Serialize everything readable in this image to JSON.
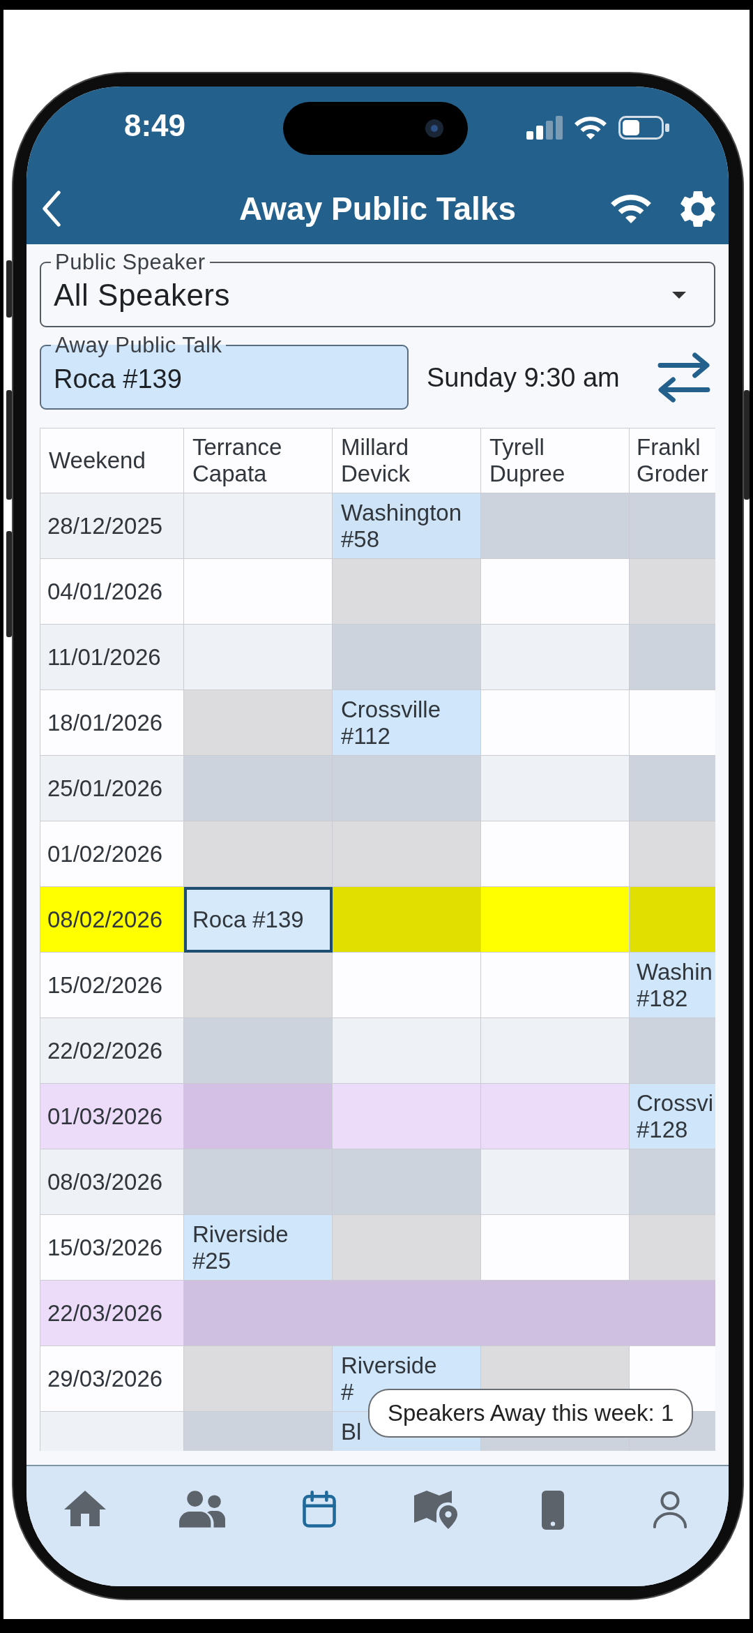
{
  "status_bar": {
    "time": "8:49"
  },
  "header": {
    "title": "Away Public Talks"
  },
  "filters": {
    "speaker": {
      "label": "Public Speaker",
      "value": "All Speakers"
    },
    "talk": {
      "label": "Away Public Talk",
      "value": "Roca #139"
    },
    "schedule_time": "Sunday 9:30 am"
  },
  "schedule": {
    "columns": [
      "Weekend",
      "Terrance Capata",
      "Millard Devick",
      "Tyrell Dupree",
      "Frankl Groder"
    ],
    "rows": [
      {
        "weekend": "28/12/2025",
        "kind": "normal",
        "cells": [
          {
            "booked": false,
            "unavailable": false,
            "selected": false
          },
          {
            "booked": true,
            "unavailable": false,
            "talk": "Washington\n#58",
            "selected": false
          },
          {
            "booked": false,
            "unavailable": true,
            "selected": false
          },
          {
            "booked": false,
            "unavailable": true,
            "selected": false
          }
        ]
      },
      {
        "weekend": "04/01/2026",
        "kind": "normal",
        "cells": [
          {
            "booked": false,
            "unavailable": false,
            "selected": false
          },
          {
            "booked": false,
            "unavailable": true,
            "selected": false
          },
          {
            "booked": false,
            "unavailable": false,
            "selected": false
          },
          {
            "booked": false,
            "unavailable": true,
            "selected": false
          }
        ]
      },
      {
        "weekend": "11/01/2026",
        "kind": "normal",
        "cells": [
          {
            "booked": false,
            "unavailable": false,
            "selected": false
          },
          {
            "booked": false,
            "unavailable": true,
            "selected": false
          },
          {
            "booked": false,
            "unavailable": false,
            "selected": false
          },
          {
            "booked": false,
            "unavailable": true,
            "selected": false
          }
        ]
      },
      {
        "weekend": "18/01/2026",
        "kind": "normal",
        "cells": [
          {
            "booked": false,
            "unavailable": true,
            "selected": false
          },
          {
            "booked": true,
            "unavailable": false,
            "talk": "Crossville\n#112",
            "selected": false
          },
          {
            "booked": false,
            "unavailable": false,
            "selected": false
          },
          {
            "booked": false,
            "unavailable": false,
            "selected": false
          }
        ]
      },
      {
        "weekend": "25/01/2026",
        "kind": "normal",
        "cells": [
          {
            "booked": false,
            "unavailable": true,
            "selected": false
          },
          {
            "booked": false,
            "unavailable": true,
            "selected": false
          },
          {
            "booked": false,
            "unavailable": false,
            "selected": false
          },
          {
            "booked": false,
            "unavailable": true,
            "selected": false
          }
        ]
      },
      {
        "weekend": "01/02/2026",
        "kind": "normal",
        "cells": [
          {
            "booked": false,
            "unavailable": true,
            "selected": false
          },
          {
            "booked": false,
            "unavailable": true,
            "selected": false
          },
          {
            "booked": false,
            "unavailable": false,
            "selected": false
          },
          {
            "booked": false,
            "unavailable": true,
            "selected": false
          }
        ]
      },
      {
        "weekend": "08/02/2026",
        "kind": "current",
        "cells": [
          {
            "booked": true,
            "unavailable": false,
            "talk": "Roca #139",
            "selected": true
          },
          {
            "booked": false,
            "unavailable": true,
            "selected": false
          },
          {
            "booked": false,
            "unavailable": false,
            "selected": false
          },
          {
            "booked": false,
            "unavailable": true,
            "selected": false
          }
        ]
      },
      {
        "weekend": "15/02/2026",
        "kind": "normal",
        "cells": [
          {
            "booked": false,
            "unavailable": true,
            "selected": false
          },
          {
            "booked": false,
            "unavailable": false,
            "selected": false
          },
          {
            "booked": false,
            "unavailable": false,
            "selected": false
          },
          {
            "booked": true,
            "unavailable": false,
            "talk": "Washin\n#182",
            "selected": false
          }
        ]
      },
      {
        "weekend": "22/02/2026",
        "kind": "normal",
        "cells": [
          {
            "booked": false,
            "unavailable": true,
            "selected": false
          },
          {
            "booked": false,
            "unavailable": false,
            "selected": false
          },
          {
            "booked": false,
            "unavailable": false,
            "selected": false
          },
          {
            "booked": false,
            "unavailable": true,
            "selected": false
          }
        ]
      },
      {
        "weekend": "01/03/2026",
        "kind": "event",
        "cells": [
          {
            "booked": false,
            "unavailable": true,
            "selected": false
          },
          {
            "booked": false,
            "unavailable": false,
            "selected": false
          },
          {
            "booked": false,
            "unavailable": false,
            "selected": false
          },
          {
            "booked": true,
            "unavailable": false,
            "talk": "Crossvi\n#128",
            "selected": false
          }
        ]
      },
      {
        "weekend": "08/03/2026",
        "kind": "normal",
        "cells": [
          {
            "booked": false,
            "unavailable": true,
            "selected": false
          },
          {
            "booked": false,
            "unavailable": true,
            "selected": false
          },
          {
            "booked": false,
            "unavailable": false,
            "selected": false
          },
          {
            "booked": false,
            "unavailable": true,
            "selected": false
          }
        ]
      },
      {
        "weekend": "15/03/2026",
        "kind": "normal",
        "cells": [
          {
            "booked": true,
            "unavailable": false,
            "talk": "Riverside\n#25",
            "selected": false
          },
          {
            "booked": false,
            "unavailable": true,
            "selected": false
          },
          {
            "booked": false,
            "unavailable": false,
            "selected": false
          },
          {
            "booked": false,
            "unavailable": true,
            "selected": false
          }
        ]
      },
      {
        "weekend": "22/03/2026",
        "kind": "closed"
      },
      {
        "weekend": "29/03/2026",
        "kind": "normal",
        "cells": [
          {
            "booked": false,
            "unavailable": true,
            "selected": false
          },
          {
            "booked": true,
            "unavailable": false,
            "talk": "Riverside\n#",
            "selected": false
          },
          {
            "booked": false,
            "unavailable": true,
            "selected": false
          },
          {
            "booked": false,
            "unavailable": false,
            "selected": false
          }
        ]
      },
      {
        "kind": "normal",
        "cells": [
          {
            "booked": false,
            "unavailable": true,
            "selected": false
          },
          {
            "booked": true,
            "unavailable": false,
            "talk": "Bl",
            "selected": false
          },
          {
            "booked": false,
            "unavailable": true,
            "selected": false
          },
          {
            "booked": false,
            "unavailable": true,
            "selected": false
          }
        ]
      }
    ]
  },
  "toast": {
    "text": "Speakers Away this week: 1"
  },
  "bottom_nav": [
    {
      "kind": "home",
      "selected": false
    },
    {
      "kind": "people",
      "selected": false
    },
    {
      "kind": "calendar",
      "selected": true
    },
    {
      "kind": "map",
      "selected": false
    },
    {
      "kind": "phone",
      "selected": false
    },
    {
      "kind": "person",
      "selected": false
    }
  ]
}
